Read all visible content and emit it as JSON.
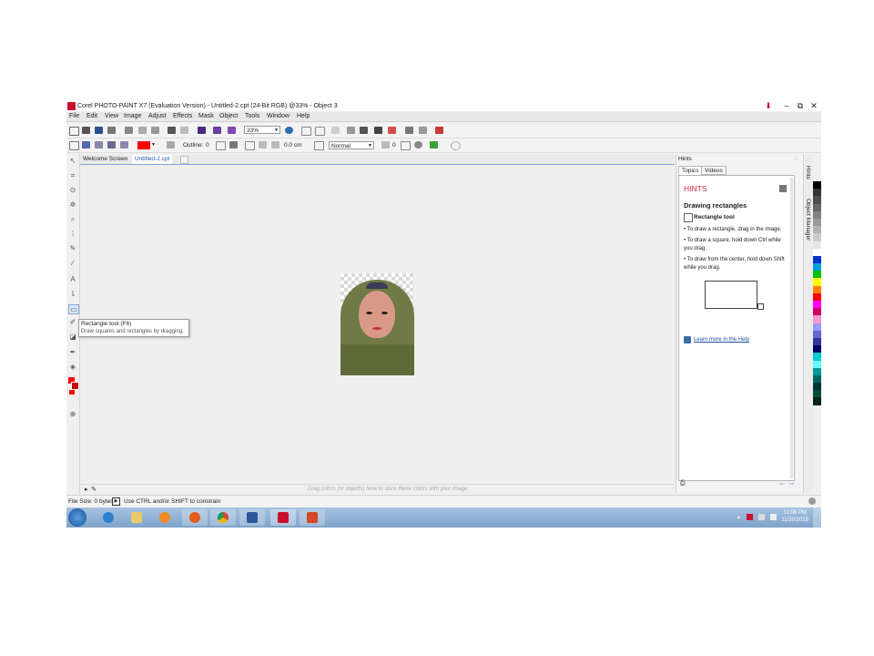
{
  "window": {
    "title": "Corel PHOTO-PAINT X7 (Evaluation Version) - Untitled-2.cpt (24-Bit RGB) @33% - Object 3",
    "minimize": "–",
    "restore": "⧉",
    "close": "✕"
  },
  "menu": [
    "File",
    "Edit",
    "View",
    "Image",
    "Adjust",
    "Effects",
    "Mask",
    "Object",
    "Tools",
    "Window",
    "Help"
  ],
  "toolbar": {
    "zoom": "33%",
    "outline_label": "Outline:",
    "outline_value": "0",
    "width_value": "0.0 cm",
    "blend_mode": "Normal",
    "transparency_value": "0"
  },
  "tabs": {
    "welcome": "Welcome Screen",
    "document": "Untitled-2.cpt"
  },
  "tooltip": {
    "title": "Rectangle tool (F6)",
    "description": "Draw squares and rectangles by dragging."
  },
  "palette_bar": {
    "drop_hint": "Drag colors (or objects) here to store these colors with your image"
  },
  "docker": {
    "title": "Hints",
    "tab_topics": "Topics",
    "tab_videos": "Videos",
    "heading": "HINTS",
    "topic_title": "Drawing rectangles",
    "tool_name": "Rectangle tool",
    "bullets": [
      "• To draw a rectangle, drag in the image.",
      "• To draw a square, hold down Ctrl while you drag.",
      "• To draw from the center, hold down Shift while you drag."
    ],
    "learn_more": "Learn more in the Help"
  },
  "side_tabs": {
    "hints": "Hints",
    "object_manager": "Object Manager"
  },
  "status": {
    "file_size": "File Size: 0 bytes",
    "message": "Use CTRL and/or SHIFT to constrain"
  },
  "taskbar": {
    "time": "11:08 PM",
    "date": "11/30/2019"
  },
  "colors": {
    "accent": "#1f5fa8",
    "fill_color": "#ff0000",
    "hints_heading": "#d0283c"
  },
  "palette_colors": [
    "#000000",
    "#333333",
    "#4d4d4d",
    "#666666",
    "#808080",
    "#999999",
    "#b3b3b3",
    "#cccccc",
    "#e6e6e6",
    "#ffffff",
    "#0033cc",
    "#00a0e0",
    "#00c000",
    "#ffff00",
    "#ff8000",
    "#ff0000",
    "#ff00ff",
    "#cc0066",
    "#ff99cc",
    "#9999ff",
    "#6666cc",
    "#333399",
    "#000066",
    "#00cccc",
    "#66ffff",
    "#009999",
    "#006666",
    "#003333",
    "#004d40",
    "#00261a"
  ]
}
